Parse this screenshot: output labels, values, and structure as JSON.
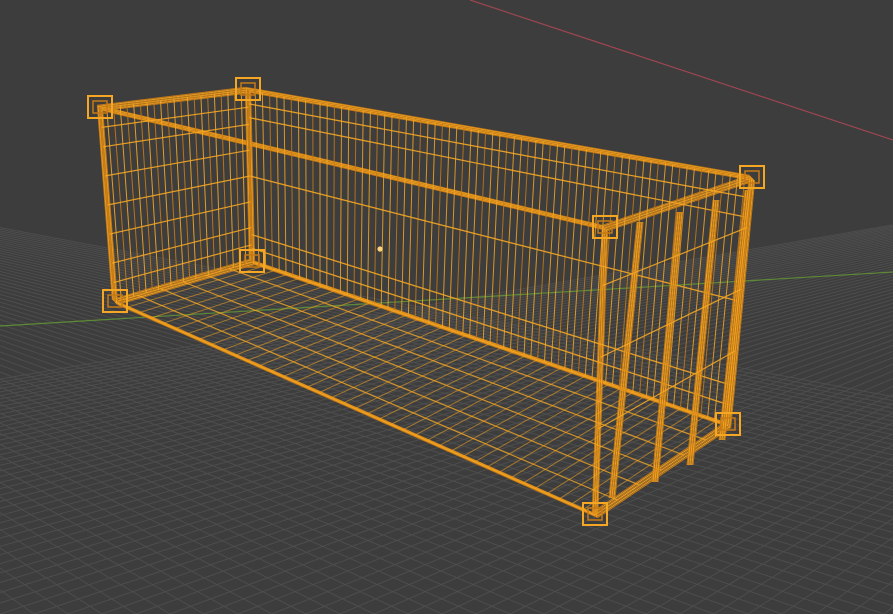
{
  "viewport": {
    "mode": "wireframe",
    "background_color": "#3d3d3d",
    "grid_color": "#4f4f4f",
    "x_axis_color": "#9c4650",
    "y_axis_color": "#5d8a36",
    "selection_color": "#f5a623",
    "origin_color": "#ffd27a"
  },
  "object": {
    "type": "shipping-container",
    "selected": true,
    "display": "wireframe"
  }
}
